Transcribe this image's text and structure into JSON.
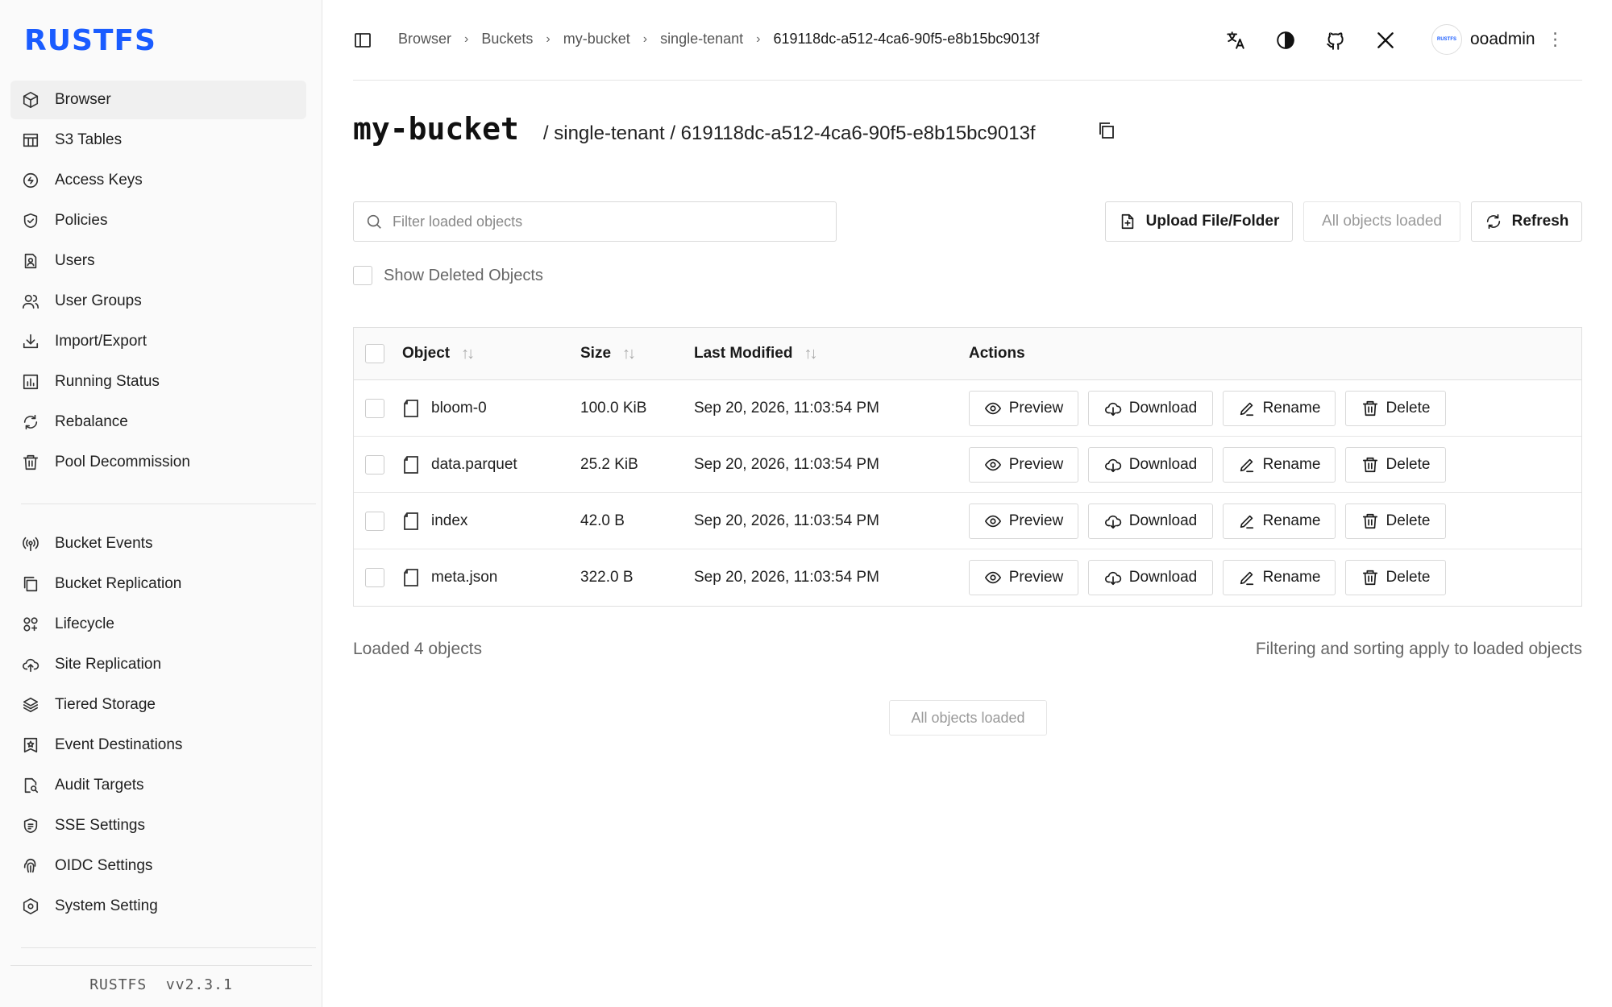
{
  "app": {
    "logo": "RUSTFS",
    "version_label": "RUSTFS",
    "version": "vv2.3.1"
  },
  "sidebar": {
    "primary": [
      {
        "label": "Browser",
        "icon": "cube-icon",
        "active": true
      },
      {
        "label": "S3 Tables",
        "icon": "table-icon"
      },
      {
        "label": "Access Keys",
        "icon": "key-circle-icon"
      },
      {
        "label": "Policies",
        "icon": "shield-check-icon"
      },
      {
        "label": "Users",
        "icon": "user-card-icon"
      },
      {
        "label": "User Groups",
        "icon": "users-icon"
      },
      {
        "label": "Import/Export",
        "icon": "download-tray-icon"
      },
      {
        "label": "Running Status",
        "icon": "bar-chart-icon"
      },
      {
        "label": "Rebalance",
        "icon": "refresh-icon"
      },
      {
        "label": "Pool Decommission",
        "icon": "trash-icon"
      }
    ],
    "secondary": [
      {
        "label": "Bucket Events",
        "icon": "broadcast-icon"
      },
      {
        "label": "Bucket Replication",
        "icon": "copy-icon"
      },
      {
        "label": "Lifecycle",
        "icon": "lifecycle-icon"
      },
      {
        "label": "Site Replication",
        "icon": "cloud-upload-icon"
      },
      {
        "label": "Tiered Storage",
        "icon": "layers-icon"
      },
      {
        "label": "Event Destinations",
        "icon": "bookmark-star-icon"
      },
      {
        "label": "Audit Targets",
        "icon": "file-search-icon"
      },
      {
        "label": "SSE Settings",
        "icon": "encryption-icon"
      },
      {
        "label": "OIDC Settings",
        "icon": "fingerprint-icon"
      },
      {
        "label": "System Setting",
        "icon": "settings-hex-icon"
      }
    ]
  },
  "header": {
    "breadcrumb": [
      "Browser",
      "Buckets",
      "my-bucket",
      "single-tenant",
      "619118dc-a512-4ca6-90f5-e8b15bc9013f"
    ],
    "user": "ooadmin",
    "avatar_text": "RUSTFS"
  },
  "page": {
    "bucket": "my-bucket",
    "path": "/ single-tenant / 619118dc-a512-4ca6-90f5-e8b15bc9013f"
  },
  "toolbar": {
    "filter_placeholder": "Filter loaded objects",
    "upload_label": "Upload File/Folder",
    "loaded_label": "All objects loaded",
    "refresh_label": "Refresh",
    "show_deleted_label": "Show Deleted Objects"
  },
  "table": {
    "columns": {
      "object": "Object",
      "size": "Size",
      "modified": "Last Modified",
      "actions": "Actions"
    },
    "actions": {
      "preview": "Preview",
      "download": "Download",
      "rename": "Rename",
      "delete": "Delete"
    },
    "rows": [
      {
        "name": "bloom-0",
        "size": "100.0 KiB",
        "modified": "Sep 20, 2026, 11:03:54 PM"
      },
      {
        "name": "data.parquet",
        "size": "25.2 KiB",
        "modified": "Sep 20, 2026, 11:03:54 PM"
      },
      {
        "name": "index",
        "size": "42.0 B",
        "modified": "Sep 20, 2026, 11:03:54 PM"
      },
      {
        "name": "meta.json",
        "size": "322.0 B",
        "modified": "Sep 20, 2026, 11:03:54 PM"
      }
    ]
  },
  "footer": {
    "loaded_count": "Loaded 4 objects",
    "note": "Filtering and sorting apply to loaded objects",
    "all_loaded": "All objects loaded"
  }
}
